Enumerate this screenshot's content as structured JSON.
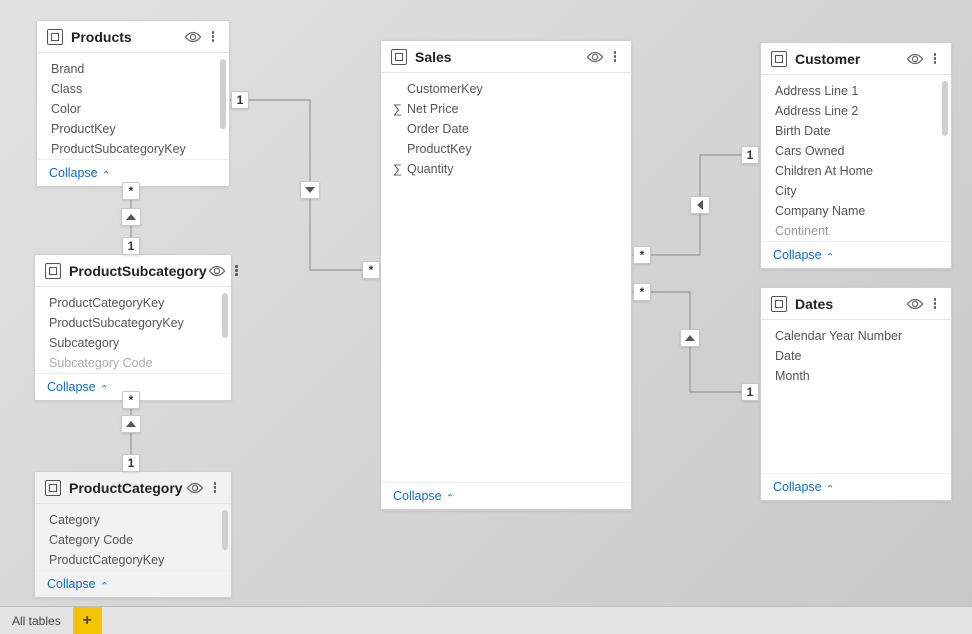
{
  "collapse_label": "Collapse",
  "bottom_tab_label": "All tables",
  "relationship_markers": {
    "many": "*",
    "one": "1"
  },
  "tables": {
    "products": {
      "title": "Products",
      "fields": [
        "Brand",
        "Class",
        "Color",
        "ProductKey",
        "ProductSubcategoryKey"
      ]
    },
    "productSubcategory": {
      "title": "ProductSubcategory",
      "fields": [
        "ProductCategoryKey",
        "ProductSubcategoryKey",
        "Subcategory",
        "Subcategory Code"
      ]
    },
    "productCategory": {
      "title": "ProductCategory",
      "fields": [
        "Category",
        "Category Code",
        "ProductCategoryKey"
      ]
    },
    "sales": {
      "title": "Sales",
      "fields": [
        {
          "name": "CustomerKey",
          "agg": false
        },
        {
          "name": "Net Price",
          "agg": true
        },
        {
          "name": "Order Date",
          "agg": false
        },
        {
          "name": "ProductKey",
          "agg": false
        },
        {
          "name": "Quantity",
          "agg": true
        }
      ]
    },
    "customer": {
      "title": "Customer",
      "fields": [
        "Address Line 1",
        "Address Line 2",
        "Birth Date",
        "Cars Owned",
        "Children At Home",
        "City",
        "Company Name",
        "Continent"
      ]
    },
    "dates": {
      "title": "Dates",
      "fields": [
        "Calendar Year Number",
        "Date",
        "Month"
      ]
    }
  },
  "relationships": [
    {
      "from": "products",
      "to": "sales",
      "from_card": "1",
      "to_card": "*"
    },
    {
      "from": "productSubcategory",
      "to": "products",
      "from_card": "1",
      "to_card": "*"
    },
    {
      "from": "productCategory",
      "to": "productSubcategory",
      "from_card": "1",
      "to_card": "*"
    },
    {
      "from": "customer",
      "to": "sales",
      "from_card": "1",
      "to_card": "*"
    },
    {
      "from": "dates",
      "to": "sales",
      "from_card": "1",
      "to_card": "*"
    }
  ]
}
